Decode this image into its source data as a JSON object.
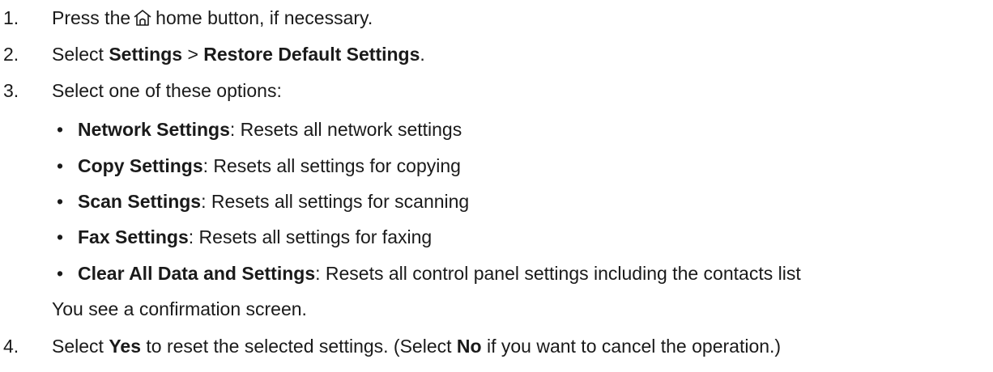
{
  "steps": [
    {
      "number": "1.",
      "before": "Press the",
      "icon": "home-icon",
      "after": "home button, if necessary."
    },
    {
      "number": "2.",
      "prefix": "Select ",
      "bold1": "Settings",
      "sep": " > ",
      "bold2": "Restore Default Settings",
      "suffix": "."
    },
    {
      "number": "3.",
      "text": "Select one of these options:",
      "options": [
        {
          "label": "Network Settings",
          "desc": ": Resets all network settings"
        },
        {
          "label": "Copy Settings",
          "desc": ": Resets all settings for copying"
        },
        {
          "label": "Scan Settings",
          "desc": ": Resets all settings for scanning"
        },
        {
          "label": "Fax Settings",
          "desc": ": Resets all settings for faxing"
        },
        {
          "label": "Clear All Data and Settings",
          "desc": ": Resets all control panel settings including the contacts list"
        }
      ],
      "note": "You see a confirmation screen."
    },
    {
      "number": "4.",
      "prefix": "Select ",
      "bold1": "Yes",
      "middle": " to reset the selected settings. (Select ",
      "bold2": "No",
      "suffix": " if you want to cancel the operation.)"
    }
  ],
  "bullet_char": "•"
}
